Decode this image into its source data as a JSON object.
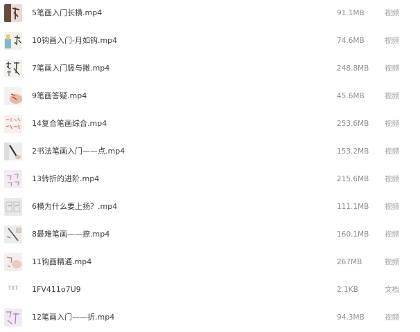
{
  "files": [
    {
      "name": "5笔画入门长横.mp4",
      "size": "91.1MB",
      "type": "视频",
      "thumb_icon": "video-thumbnail"
    },
    {
      "name": "10钩画入门-月如钩.mp4",
      "size": "74.6MB",
      "type": "视频",
      "thumb_icon": "video-thumbnail"
    },
    {
      "name": "7笔画入门竖与撇.mp4",
      "size": "248.8MB",
      "type": "视频",
      "thumb_icon": "video-thumbnail"
    },
    {
      "name": "9笔画答疑.mp4",
      "size": "45.6MB",
      "type": "视频",
      "thumb_icon": "video-thumbnail"
    },
    {
      "name": "14复合笔画综合.mp4",
      "size": "253.6MB",
      "type": "视频",
      "thumb_icon": "video-thumbnail"
    },
    {
      "name": "2书法笔画入门——点.mp4",
      "size": "153.2MB",
      "type": "视频",
      "thumb_icon": "video-thumbnail"
    },
    {
      "name": "13转折的进阶.mp4",
      "size": "215.6MB",
      "type": "视频",
      "thumb_icon": "video-thumbnail"
    },
    {
      "name": "6横为什么要上扬？.mp4",
      "size": "111.1MB",
      "type": "视频",
      "thumb_icon": "video-thumbnail"
    },
    {
      "name": "8最难笔画——捺.mp4",
      "size": "160.1MB",
      "type": "视频",
      "thumb_icon": "video-thumbnail"
    },
    {
      "name": "11钩画精通.mp4",
      "size": "267MB",
      "type": "视频",
      "thumb_icon": "video-thumbnail"
    },
    {
      "name": "1FV411o7U9",
      "size": "2.1KB",
      "type": "文档",
      "thumb_icon": "txt-file-icon",
      "thumb_label": "TXT"
    },
    {
      "name": "12笔画入门——折.mp4",
      "size": "94.3MB",
      "type": "视频",
      "thumb_icon": "video-thumbnail"
    }
  ]
}
